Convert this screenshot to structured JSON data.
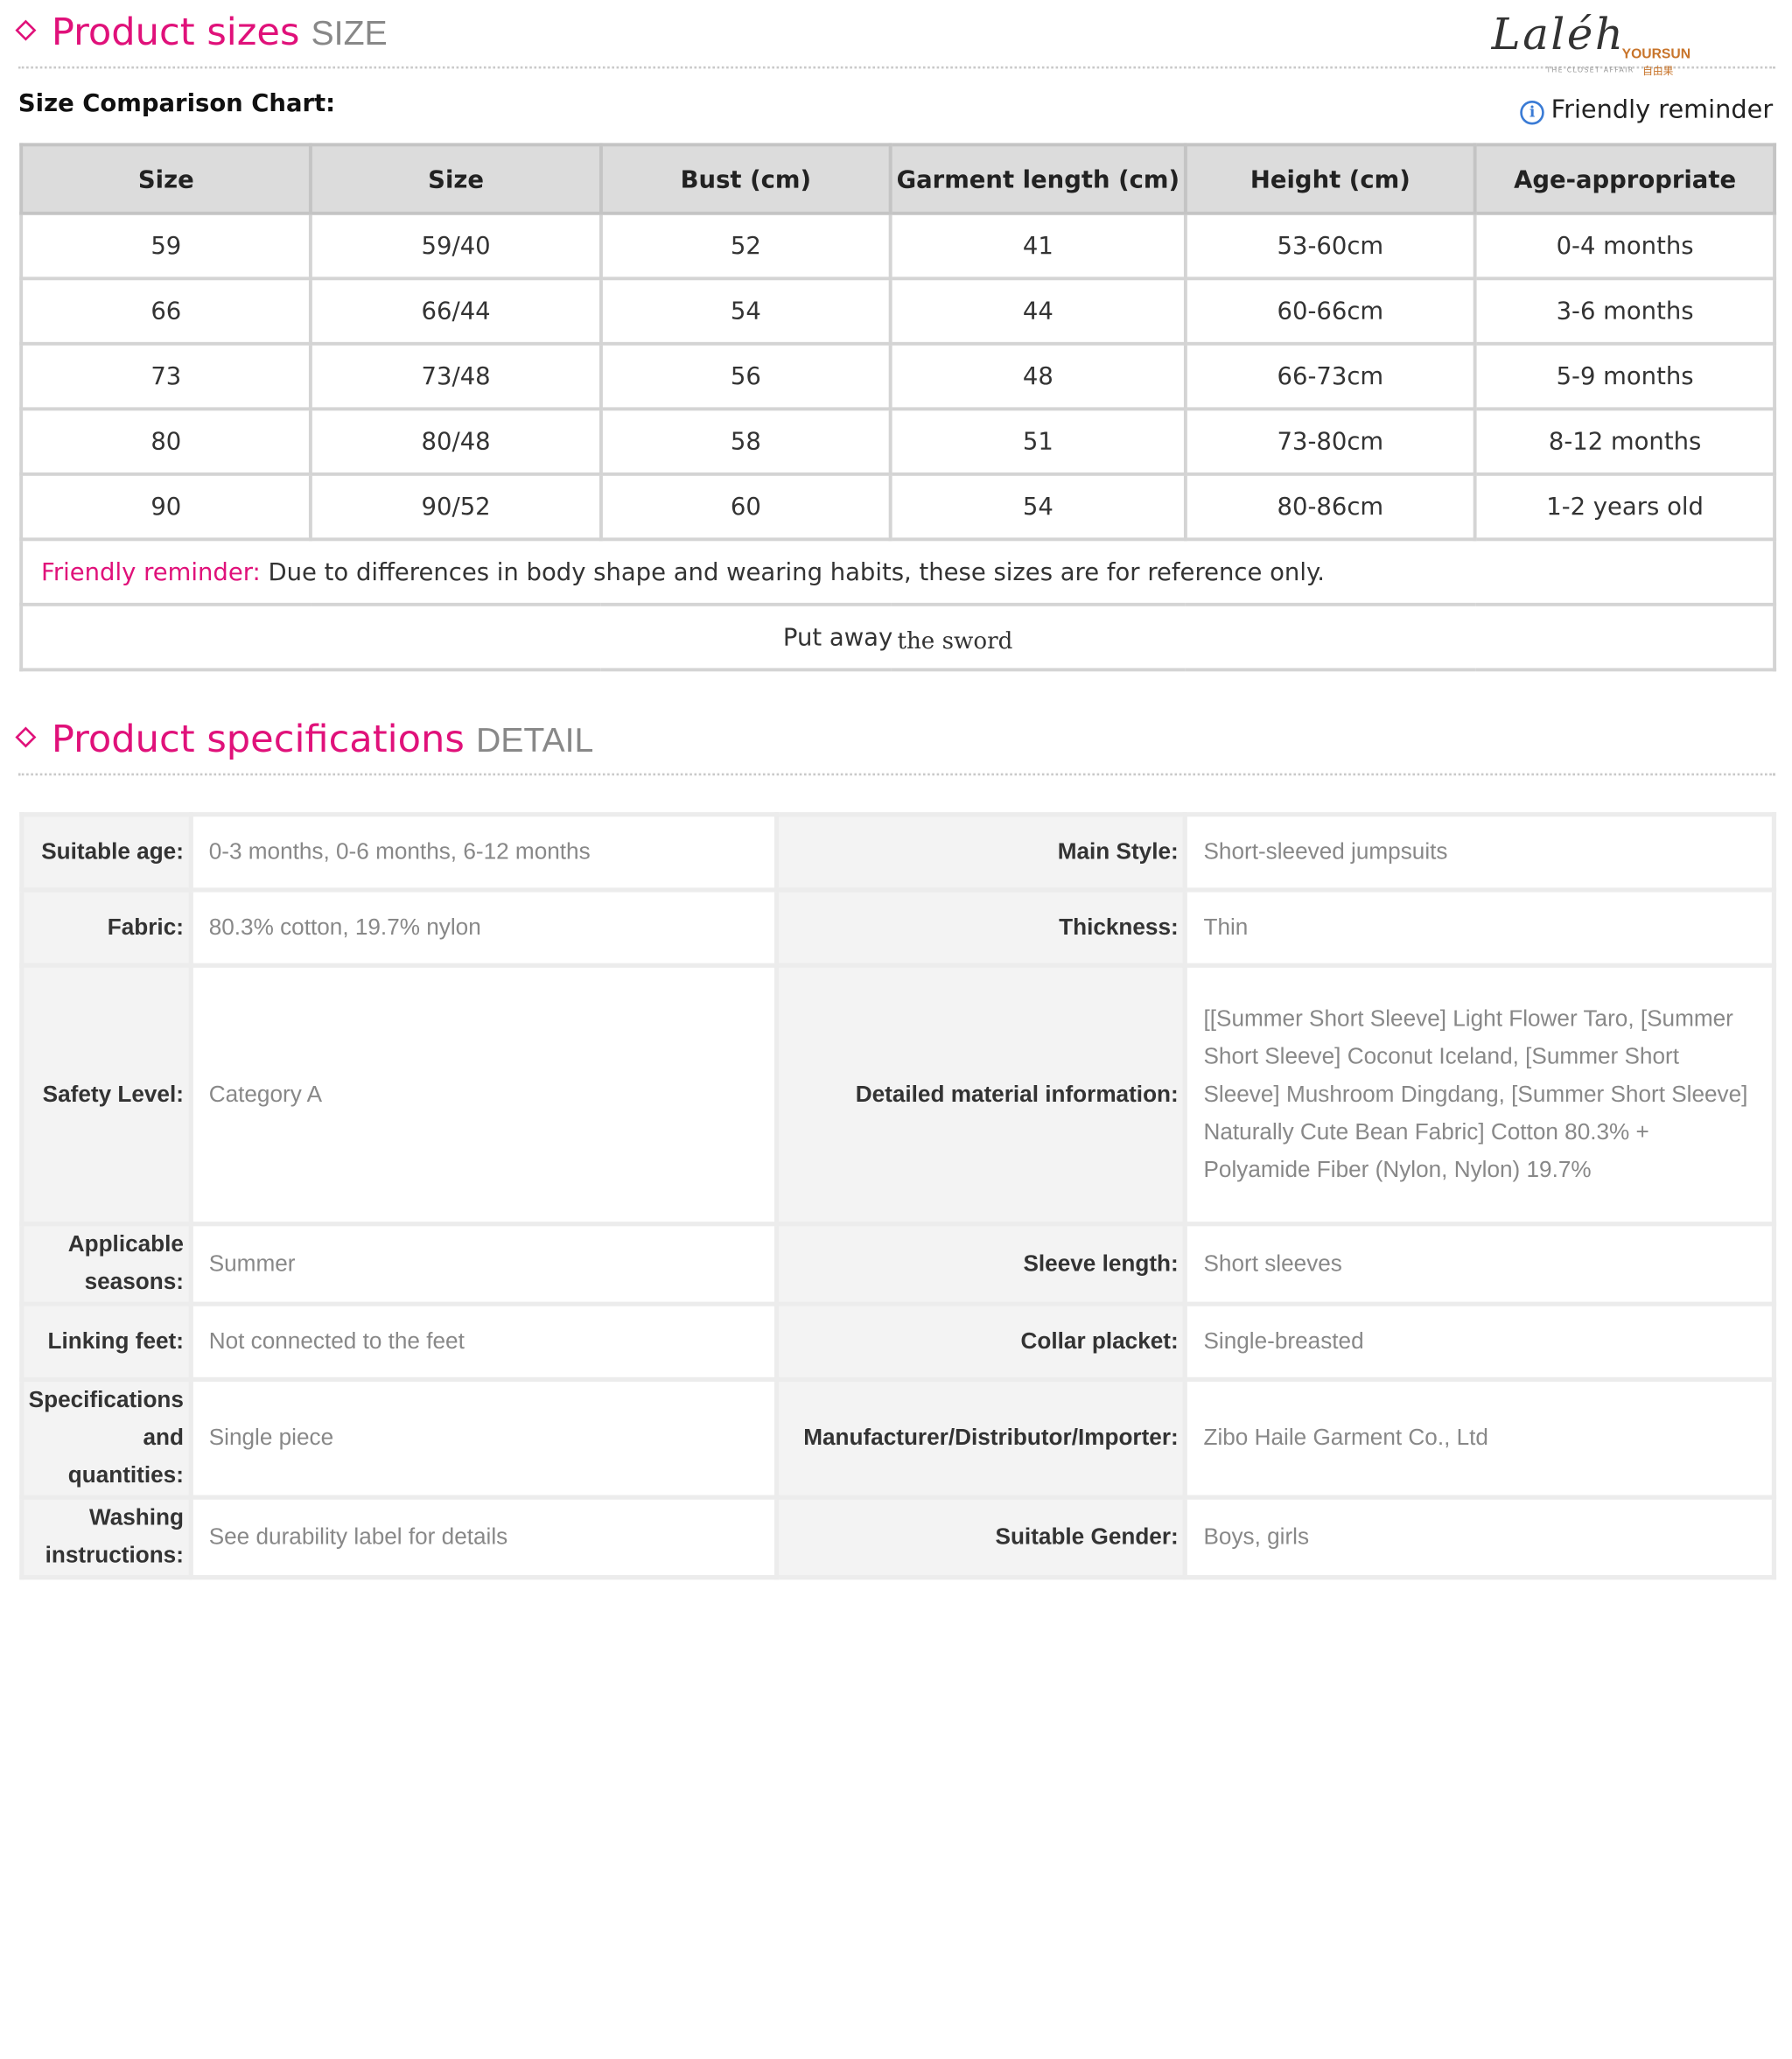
{
  "size_section": {
    "title": "Product sizes",
    "subtitle": "SIZE"
  },
  "logo": {
    "script": "Laléh",
    "tagline": "THE CLOSET AFFAIR",
    "brand": "YOURSUN",
    "brand_cn": "自由果"
  },
  "chart_title": "Size Comparison Chart:",
  "reminder_link": "Friendly reminder",
  "size_table": {
    "headers": [
      "Size",
      "Size",
      "Bust (cm)",
      "Garment length (cm)",
      "Height (cm)",
      "Age-appropriate"
    ],
    "rows": [
      [
        "59",
        "59/40",
        "52",
        "41",
        "53-60cm",
        "0-4 months"
      ],
      [
        "66",
        "66/44",
        "54",
        "44",
        "60-66cm",
        "3-6 months"
      ],
      [
        "73",
        "73/48",
        "56",
        "48",
        "66-73cm",
        "5-9 months"
      ],
      [
        "80",
        "80/48",
        "58",
        "51",
        "73-80cm",
        "8-12 months"
      ],
      [
        "90",
        "90/52",
        "60",
        "54",
        "80-86cm",
        "1-2 years old"
      ]
    ],
    "note_label": "Friendly reminder:",
    "note_text": " Due to differences in body shape and wearing habits, these sizes are for reference only.",
    "footer_a": "Put away",
    "footer_b": "the  sword"
  },
  "spec_section": {
    "title": "Product specifications",
    "subtitle": "DETAIL"
  },
  "specs": {
    "suitable_age": {
      "label": "Suitable age:",
      "value": "0-3 months, 0-6 months, 6-12 months"
    },
    "main_style": {
      "label": "Main Style:",
      "value": "Short-sleeved jumpsuits"
    },
    "fabric": {
      "label": "Fabric:",
      "value": "80.3% cotton, 19.7% nylon"
    },
    "thickness": {
      "label": "Thickness:",
      "value": "Thin"
    },
    "safety": {
      "label": "Safety Level:",
      "value": "Category A"
    },
    "material": {
      "label": "Detailed material information:",
      "value": "[[Summer Short Sleeve] Light Flower Taro, [Summer Short Sleeve] Coconut Iceland, [Summer Short Sleeve] Mushroom Dingdang, [Summer Short Sleeve] Naturally Cute Bean Fabric] Cotton 80.3% + Polyamide Fiber (Nylon, Nylon) 19.7%"
    },
    "seasons": {
      "label": "Applicable seasons:",
      "value": "Summer"
    },
    "sleeve": {
      "label": "Sleeve length:",
      "value": "Short sleeves"
    },
    "feet": {
      "label": "Linking feet:",
      "value": "Not connected to the feet"
    },
    "collar": {
      "label": "Collar placket:",
      "value": "Single-breasted"
    },
    "quantities": {
      "label": "Specifications and quantities:",
      "value": "Single piece"
    },
    "manufacturer": {
      "label": "Manufacturer/Distributor/Importer:",
      "value": "Zibo Haile Garment Co., Ltd"
    },
    "washing": {
      "label": "Washing instructions:",
      "value": "See durability label for details"
    },
    "gender": {
      "label": "Suitable Gender:",
      "value": "Boys, girls"
    }
  }
}
